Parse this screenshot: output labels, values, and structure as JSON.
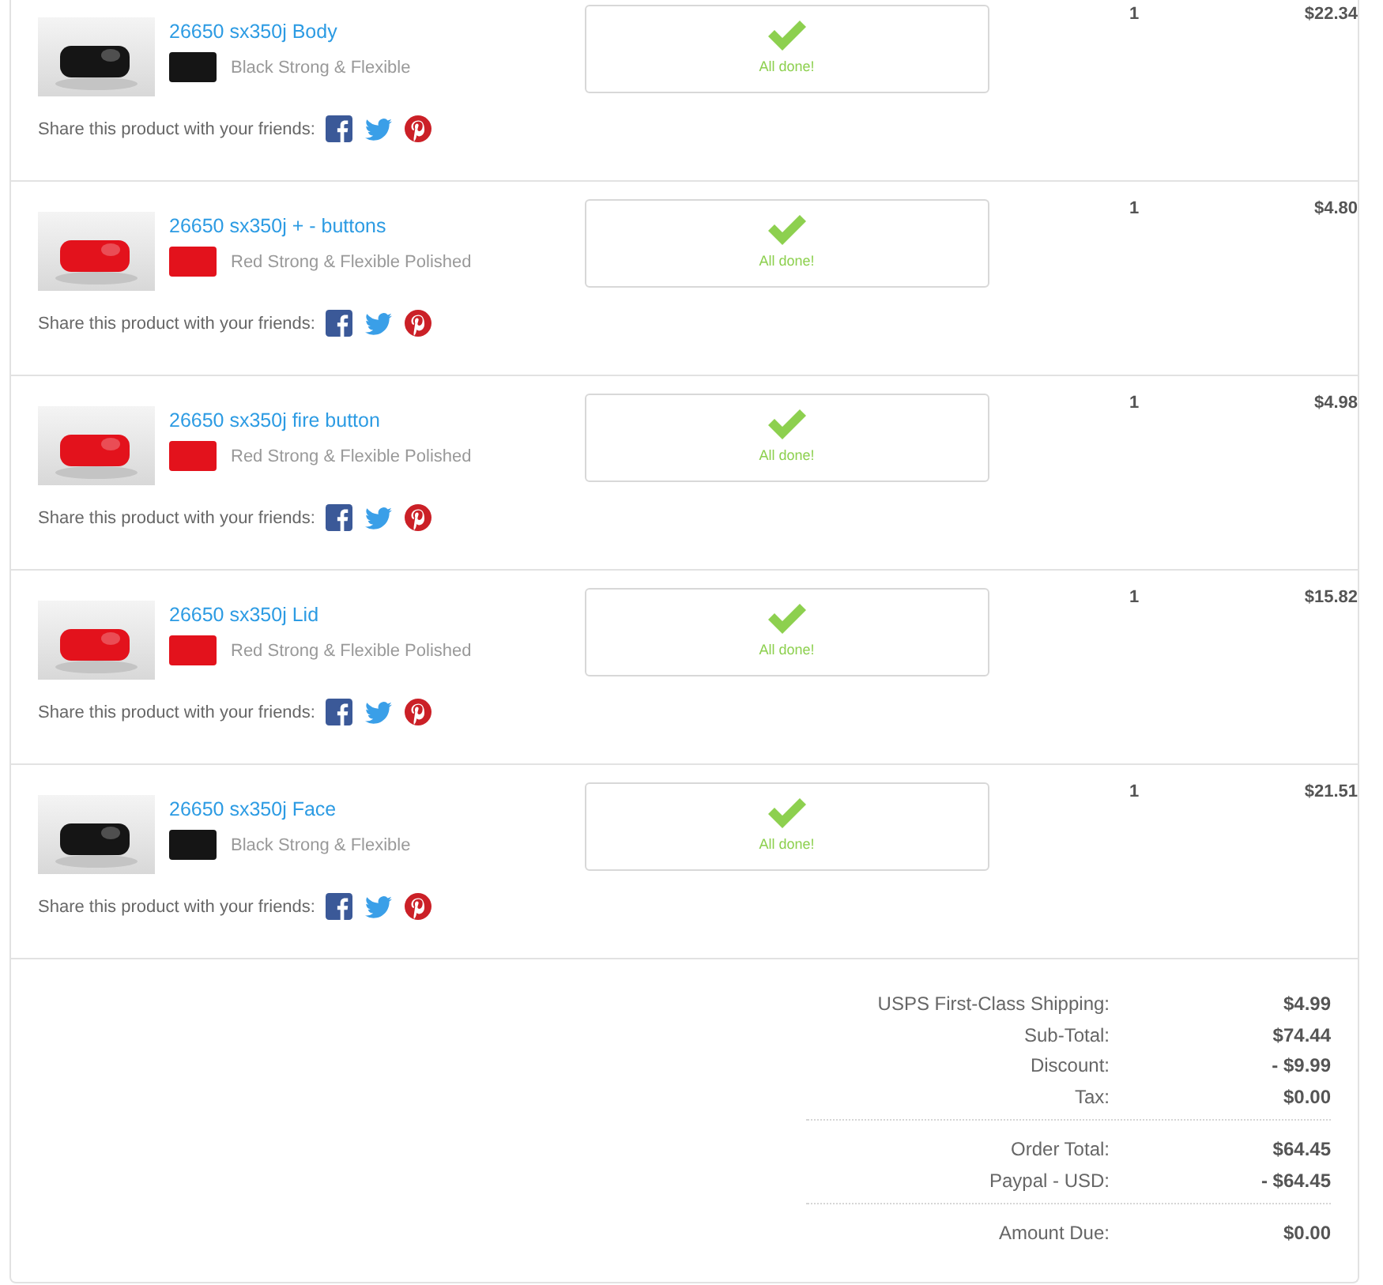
{
  "products": [
    {
      "name": "26650 sx350j Body",
      "material": "Black Strong & Flexible",
      "color": "#151515",
      "share_label": "Share this product with your friends:",
      "status": "All done!",
      "quantity": "1",
      "price": "$22.34"
    },
    {
      "name": "26650 sx350j + - buttons",
      "material": "Red Strong & Flexible Polished",
      "color": "#e3121c",
      "share_label": "Share this product with your friends:",
      "status": "All done!",
      "quantity": "1",
      "price": "$4.80"
    },
    {
      "name": "26650 sx350j fire button",
      "material": "Red Strong & Flexible Polished",
      "color": "#e3121c",
      "share_label": "Share this product with your friends:",
      "status": "All done!",
      "quantity": "1",
      "price": "$4.98"
    },
    {
      "name": "26650 sx350j Lid",
      "material": "Red Strong & Flexible Polished",
      "color": "#e3121c",
      "share_label": "Share this product with your friends:",
      "status": "All done!",
      "quantity": "1",
      "price": "$15.82"
    },
    {
      "name": "26650 sx350j Face",
      "material": "Black Strong & Flexible",
      "color": "#151515",
      "share_label": "Share this product with your friends:",
      "status": "All done!",
      "quantity": "1",
      "price": "$21.51"
    }
  ],
  "summary": {
    "groups": [
      [
        {
          "label": "USPS First-Class Shipping:",
          "value": "$4.99"
        },
        {
          "label": "Sub-Total:",
          "value": "$74.44"
        },
        {
          "label": "Discount:",
          "value": "- $9.99"
        },
        {
          "label": "Tax:",
          "value": "$0.00"
        }
      ],
      [
        {
          "label": "Order Total:",
          "value": "$64.45"
        },
        {
          "label": "Paypal - USD:",
          "value": "- $64.45"
        }
      ],
      [
        {
          "label": "Amount Due:",
          "value": "$0.00"
        }
      ]
    ]
  }
}
